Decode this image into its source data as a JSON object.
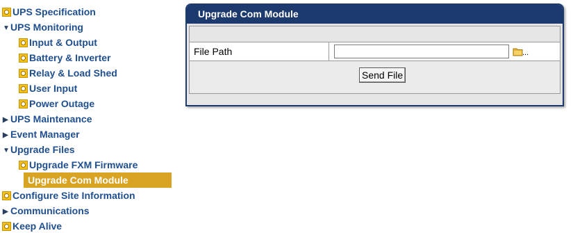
{
  "sidebar": {
    "items": [
      {
        "label": "UPS Specification"
      },
      {
        "label": "UPS Monitoring"
      },
      {
        "label": "Input & Output"
      },
      {
        "label": "Battery & Inverter"
      },
      {
        "label": "Relay & Load Shed"
      },
      {
        "label": "User Input"
      },
      {
        "label": "Power Outage"
      },
      {
        "label": "UPS Maintenance"
      },
      {
        "label": "Event Manager"
      },
      {
        "label": "Upgrade Files"
      },
      {
        "label": "Upgrade FXM Firmware"
      },
      {
        "label": "Upgrade Com Module"
      },
      {
        "label": "Configure Site Information"
      },
      {
        "label": "Communications"
      },
      {
        "label": "Keep Alive"
      }
    ]
  },
  "panel": {
    "title": "Upgrade Com Module",
    "file_path_label": "File Path",
    "file_path_value": "",
    "browse_dots": "...",
    "send_label": "Send File"
  },
  "colors": {
    "nav_text": "#1f4f8f",
    "active_bg": "#d9a324",
    "header_bg": "#1d3a6e",
    "panel_bg": "#e6e6e6"
  },
  "icons": {
    "leaf": "gear-icon",
    "expanded": "triangle-down-icon",
    "collapsed": "triangle-right-icon",
    "browse": "folder-icon"
  }
}
